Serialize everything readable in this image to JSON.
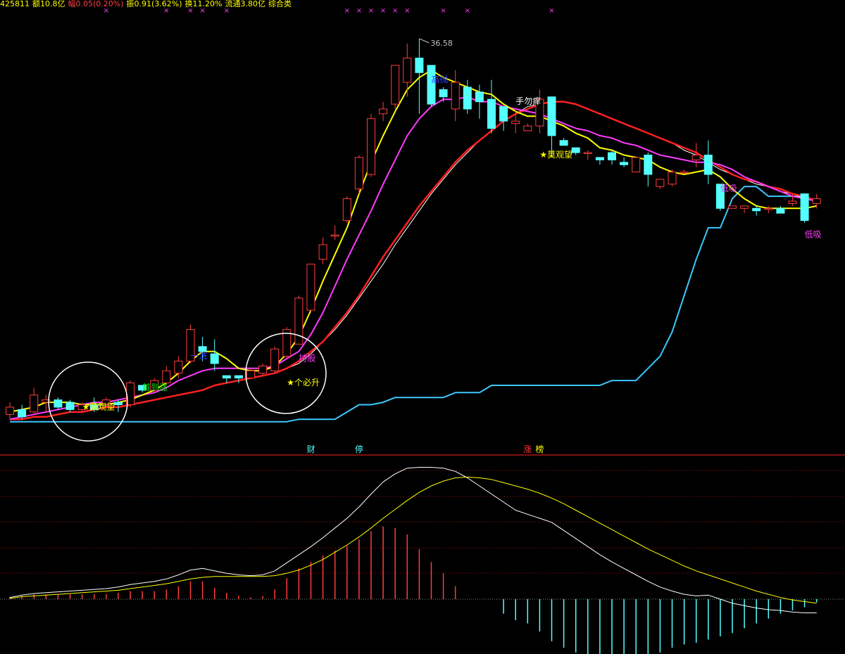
{
  "header": {
    "items": [
      {
        "text": "425811",
        "color": "#ffff00"
      },
      {
        "text": "额10.8亿",
        "color": "#ffff00"
      },
      {
        "text": "幅0.05(0.20%)",
        "color": "#ff4040"
      },
      {
        "text": "振0.91(3.62%)",
        "color": "#ffff00"
      },
      {
        "text": "换11.20%",
        "color": "#ffff00"
      },
      {
        "text": "流通3.80亿",
        "color": "#ffff00"
      },
      {
        "text": "综合类",
        "color": "#ffff00"
      }
    ]
  },
  "colors": {
    "up": "#ff3c3c",
    "down": "#54ffff",
    "ma_fast": "#ffff00",
    "ma_mid": "#ff3cff",
    "ma_slow": "#ff2020",
    "ma_white": "#ffffff",
    "band": "#3cc8ff",
    "divider": "#ff2020"
  },
  "chart_data": [
    {
      "type": "candlestick",
      "high_label": "36.58",
      "candles": [
        [
          21.1,
          21.4,
          20.9,
          21.6
        ],
        [
          21.3,
          21.0,
          20.9,
          21.5
        ],
        [
          21.2,
          21.9,
          21.1,
          22.2
        ],
        [
          21.6,
          21.7,
          21.2,
          21.9
        ],
        [
          21.7,
          21.4,
          21.3,
          21.8
        ],
        [
          21.6,
          21.3,
          21.2,
          21.7
        ],
        [
          21.3,
          21.5,
          21.2,
          21.6
        ],
        [
          21.5,
          21.3,
          21.2,
          21.8
        ],
        [
          21.5,
          21.7,
          21.4,
          21.8
        ],
        [
          21.6,
          21.5,
          21.2,
          21.7
        ],
        [
          21.5,
          22.4,
          21.4,
          22.5
        ],
        [
          22.3,
          22.1,
          22.0,
          22.3
        ],
        [
          22.1,
          22.5,
          22.0,
          22.6
        ],
        [
          22.4,
          22.9,
          22.3,
          23.1
        ],
        [
          22.8,
          23.3,
          22.6,
          23.5
        ],
        [
          23.3,
          24.6,
          23.2,
          24.8
        ],
        [
          23.9,
          23.7,
          23.3,
          24.3
        ],
        [
          23.6,
          23.2,
          22.9,
          24.2
        ],
        [
          22.7,
          22.6,
          22.4,
          22.7
        ],
        [
          22.7,
          22.6,
          22.4,
          22.6
        ],
        [
          22.6,
          22.9,
          22.6,
          23.0
        ],
        [
          22.8,
          23.1,
          22.7,
          23.2
        ],
        [
          22.9,
          23.8,
          22.8,
          23.9
        ],
        [
          23.5,
          24.6,
          23.4,
          24.7
        ],
        [
          24.0,
          25.9,
          24.0,
          26.0
        ],
        [
          25.4,
          27.3,
          25.3,
          27.3
        ],
        [
          27.5,
          28.1,
          27.3,
          28.4
        ],
        [
          28.5,
          28.5,
          28.3,
          28.9
        ],
        [
          29.1,
          30.0,
          29.0,
          30.1
        ],
        [
          30.4,
          31.7,
          30.2,
          31.8
        ],
        [
          31.0,
          33.3,
          30.9,
          33.5
        ],
        [
          33.5,
          33.7,
          33.2,
          34.0
        ],
        [
          33.9,
          35.5,
          33.7,
          35.5
        ],
        [
          34.8,
          35.8,
          34.2,
          36.4
        ],
        [
          35.8,
          35.2,
          33.5,
          36.6
        ],
        [
          35.5,
          33.9,
          33.8,
          35.5
        ],
        [
          34.5,
          34.2,
          34.0,
          34.6
        ],
        [
          33.7,
          34.8,
          33.2,
          35.3
        ],
        [
          34.6,
          33.7,
          33.5,
          34.9
        ],
        [
          34.4,
          34.0,
          33.3,
          34.7
        ],
        [
          34.1,
          32.9,
          32.7,
          34.9
        ],
        [
          33.8,
          33.2,
          32.8,
          33.8
        ],
        [
          33.1,
          33.2,
          32.7,
          33.7
        ],
        [
          32.8,
          33.0,
          32.8,
          33.1
        ],
        [
          33.0,
          34.1,
          32.7,
          34.5
        ],
        [
          34.2,
          32.6,
          31.7,
          34.2
        ],
        [
          32.4,
          32.2,
          32.2,
          32.5
        ],
        [
          32.1,
          31.9,
          31.8,
          32.1
        ],
        [
          31.9,
          31.9,
          31.6,
          32.0
        ],
        [
          31.7,
          31.6,
          31.4,
          31.7
        ],
        [
          31.9,
          31.6,
          31.4,
          32.0
        ],
        [
          31.5,
          31.4,
          31.3,
          31.7
        ],
        [
          31.1,
          31.7,
          31.1,
          31.7
        ],
        [
          31.8,
          31.0,
          30.5,
          31.9
        ],
        [
          30.5,
          30.8,
          30.4,
          30.8
        ],
        [
          30.6,
          31.1,
          30.5,
          31.2
        ],
        [
          31.1,
          31.1,
          31.1,
          31.2
        ],
        [
          31.6,
          31.8,
          31.3,
          32.3
        ],
        [
          31.8,
          31.0,
          30.6,
          32.4
        ],
        [
          30.6,
          29.6,
          29.5,
          30.6
        ],
        [
          29.6,
          29.7,
          29.6,
          29.7
        ],
        [
          29.6,
          29.7,
          29.4,
          29.7
        ],
        [
          29.6,
          29.5,
          29.3,
          29.7
        ],
        [
          29.6,
          29.6,
          29.4,
          29.7
        ],
        [
          29.6,
          29.4,
          29.4,
          29.7
        ],
        [
          29.8,
          29.9,
          29.7,
          30.2
        ],
        [
          30.2,
          29.1,
          29.0,
          30.2
        ],
        [
          29.8,
          30.0,
          29.6,
          30.2
        ]
      ],
      "ma_fast": [
        21.2,
        21.3,
        21.4,
        21.6,
        21.6,
        21.6,
        21.5,
        21.5,
        21.5,
        21.6,
        21.7,
        21.9,
        22.1,
        22.4,
        22.8,
        23.3,
        23.7,
        23.7,
        23.4,
        23.0,
        22.9,
        22.9,
        23.1,
        23.6,
        24.3,
        25.4,
        26.6,
        27.7,
        28.8,
        30.2,
        31.5,
        32.6,
        33.6,
        34.5,
        35.0,
        35.3,
        35.0,
        34.8,
        34.6,
        34.4,
        34.3,
        33.9,
        33.6,
        33.4,
        33.4,
        33.2,
        33.0,
        32.7,
        32.5,
        32.1,
        32.0,
        31.8,
        31.7,
        31.6,
        31.3,
        31.1,
        31.0,
        31.1,
        31.2,
        30.9,
        30.4,
        30.0,
        29.7,
        29.6,
        29.6,
        29.6,
        29.6,
        29.7
      ],
      "ma_mid": [
        20.9,
        21.0,
        21.1,
        21.2,
        21.3,
        21.4,
        21.5,
        21.6,
        21.6,
        21.7,
        21.8,
        21.9,
        22.0,
        22.2,
        22.5,
        22.7,
        22.9,
        23.0,
        23.0,
        23.0,
        23.0,
        23.0,
        23.1,
        23.4,
        23.7,
        24.4,
        25.3,
        26.4,
        27.5,
        28.5,
        29.5,
        30.6,
        31.6,
        32.6,
        33.3,
        33.8,
        34.1,
        34.1,
        34.2,
        34.0,
        34.0,
        33.8,
        33.7,
        33.6,
        33.5,
        33.3,
        33.1,
        32.9,
        32.8,
        32.6,
        32.5,
        32.3,
        32.2,
        32.0,
        31.8,
        31.7,
        31.6,
        31.5,
        31.5,
        31.4,
        31.2,
        30.9,
        30.7,
        30.5,
        30.3,
        30.1,
        30.0,
        29.9
      ],
      "ma_slow": [
        20.9,
        20.9,
        21.0,
        21.0,
        21.1,
        21.2,
        21.2,
        21.3,
        21.4,
        21.4,
        21.5,
        21.6,
        21.7,
        21.8,
        21.9,
        22.0,
        22.1,
        22.3,
        22.4,
        22.5,
        22.6,
        22.7,
        22.8,
        23.0,
        23.3,
        23.7,
        24.1,
        24.7,
        25.3,
        26.0,
        26.8,
        27.6,
        28.3,
        29.0,
        29.7,
        30.3,
        30.9,
        31.5,
        32.0,
        32.4,
        32.8,
        33.2,
        33.5,
        33.7,
        33.9,
        34.0,
        34.0,
        33.9,
        33.7,
        33.5,
        33.3,
        33.1,
        32.9,
        32.7,
        32.5,
        32.3,
        32.1,
        31.9,
        31.6,
        31.3,
        31.0,
        30.8,
        30.7,
        30.5,
        30.4,
        30.2,
        30.1,
        29.9
      ],
      "ma_white": [
        20.9,
        20.9,
        21.0,
        21.0,
        21.1,
        21.2,
        21.2,
        21.3,
        21.4,
        21.4,
        21.5,
        21.6,
        21.7,
        21.8,
        21.9,
        22.0,
        22.1,
        22.3,
        22.4,
        22.5,
        22.6,
        22.7,
        22.8,
        23.0,
        23.2,
        23.6,
        24.1,
        24.6,
        25.2,
        25.9,
        26.6,
        27.3,
        28.1,
        28.8,
        29.5,
        30.2,
        30.8,
        31.4,
        31.9,
        32.4,
        32.8,
        33.2,
        33.5,
        33.8,
        33.9,
        34.0,
        34.0,
        33.9,
        33.7,
        33.5,
        33.3,
        33.1,
        32.9,
        32.7,
        32.5,
        32.3,
        32.0,
        31.8,
        31.5,
        31.2,
        31.0,
        30.8,
        30.6,
        30.5,
        30.3,
        30.2,
        30.0,
        29.9
      ],
      "band": [
        [
          0,
          20.8
        ],
        [
          23,
          20.8
        ],
        [
          24,
          20.9
        ],
        [
          27,
          20.9
        ],
        [
          28,
          21.2
        ],
        [
          29,
          21.5
        ],
        [
          30,
          21.5
        ],
        [
          31,
          21.6
        ],
        [
          32,
          21.8
        ],
        [
          36,
          21.8
        ],
        [
          37,
          22.0
        ],
        [
          39,
          22.0
        ],
        [
          40,
          22.3
        ],
        [
          49,
          22.3
        ],
        [
          50,
          22.5
        ],
        [
          52,
          22.5
        ],
        [
          53,
          23.0
        ],
        [
          54,
          23.5
        ],
        [
          55,
          24.5
        ],
        [
          56,
          26.0
        ],
        [
          57,
          27.5
        ],
        [
          58,
          28.8
        ],
        [
          59,
          28.8
        ],
        [
          60,
          30.0
        ],
        [
          61,
          30.5
        ],
        [
          62,
          30.5
        ],
        [
          63,
          30.1
        ],
        [
          66,
          30.1
        ],
        [
          67,
          29.9
        ]
      ],
      "labels": [
        {
          "text": "★莫观望",
          "i": 6,
          "price": 21.3,
          "color": "#ffff00"
        },
        {
          "text": "首到涨",
          "i": 11,
          "price": 22.1,
          "color": "#00e000"
        },
        {
          "text": "一洗",
          "i": 15,
          "price": 23.4,
          "color": "#3040ff"
        },
        {
          "text": "持股",
          "i": 24,
          "price": 23.3,
          "color": "#ff3cff"
        },
        {
          "text": "★个必升",
          "i": 23,
          "price": 22.3,
          "color": "#ffff00"
        },
        {
          "text": "高抛",
          "i": 35,
          "price": 34.8,
          "color": "#3040ff"
        },
        {
          "text": "手勿痒",
          "i": 42,
          "price": 33.9,
          "color": "#ffffff"
        },
        {
          "text": "★莫观望",
          "i": 44,
          "price": 31.7,
          "color": "#ffff00"
        },
        {
          "text": "低吸",
          "i": 59,
          "price": 30.3,
          "color": "#ff3cff"
        },
        {
          "text": "低吸",
          "i": 66,
          "price": 28.4,
          "color": "#ff3cff"
        }
      ],
      "top_markers": [
        8,
        13,
        15,
        16,
        18,
        28,
        29,
        30,
        31,
        32,
        33,
        36,
        38,
        45
      ],
      "bottom_markers": [
        {
          "text": "财",
          "i": 25,
          "color": "#54ffff"
        },
        {
          "text": "停",
          "i": 29,
          "color": "#54ffff"
        },
        {
          "text": "涨",
          "i": 43,
          "color": "#ff3c3c"
        },
        {
          "text": "榜",
          "i": 44,
          "color": "#ffff00"
        }
      ]
    },
    {
      "type": "macd",
      "ylim": [
        -1.0,
        1.7
      ],
      "dif": [
        0.02,
        0.05,
        0.07,
        0.08,
        0.09,
        0.1,
        0.11,
        0.12,
        0.13,
        0.15,
        0.18,
        0.2,
        0.22,
        0.25,
        0.3,
        0.36,
        0.38,
        0.35,
        0.32,
        0.3,
        0.29,
        0.3,
        0.35,
        0.45,
        0.55,
        0.65,
        0.76,
        0.88,
        1.0,
        1.14,
        1.3,
        1.45,
        1.55,
        1.62,
        1.63,
        1.63,
        1.62,
        1.58,
        1.5,
        1.4,
        1.3,
        1.2,
        1.1,
        1.05,
        1.0,
        0.95,
        0.85,
        0.75,
        0.65,
        0.55,
        0.46,
        0.38,
        0.3,
        0.22,
        0.15,
        0.1,
        0.06,
        0.04,
        0.05,
        0.0,
        -0.05,
        -0.08,
        -0.11,
        -0.13,
        -0.14,
        -0.16,
        -0.17,
        -0.17
      ],
      "dea": [
        0.01,
        0.03,
        0.04,
        0.05,
        0.06,
        0.07,
        0.08,
        0.09,
        0.1,
        0.11,
        0.13,
        0.15,
        0.17,
        0.19,
        0.22,
        0.25,
        0.27,
        0.28,
        0.28,
        0.28,
        0.28,
        0.28,
        0.29,
        0.32,
        0.36,
        0.42,
        0.49,
        0.58,
        0.67,
        0.77,
        0.88,
        1.0,
        1.11,
        1.22,
        1.32,
        1.4,
        1.46,
        1.5,
        1.51,
        1.5,
        1.48,
        1.44,
        1.4,
        1.36,
        1.31,
        1.25,
        1.18,
        1.1,
        1.02,
        0.94,
        0.86,
        0.78,
        0.7,
        0.62,
        0.55,
        0.48,
        0.41,
        0.35,
        0.3,
        0.25,
        0.2,
        0.15,
        0.1,
        0.06,
        0.02,
        -0.01,
        -0.03,
        -0.05
      ],
      "hist": [
        0.03,
        0.04,
        0.06,
        0.06,
        0.06,
        0.06,
        0.06,
        0.06,
        0.06,
        0.08,
        0.1,
        0.1,
        0.1,
        0.12,
        0.16,
        0.22,
        0.22,
        0.14,
        0.08,
        0.04,
        0.02,
        0.04,
        0.12,
        0.26,
        0.38,
        0.46,
        0.54,
        0.6,
        0.66,
        0.74,
        0.84,
        0.9,
        0.88,
        0.8,
        0.62,
        0.46,
        0.32,
        0.16,
        0,
        0,
        0,
        -0.18,
        -0.26,
        -0.3,
        -0.4,
        -0.52,
        -0.6,
        -0.66,
        -0.7,
        -0.74,
        -0.76,
        -0.74,
        -0.74,
        -0.7,
        -0.66,
        -0.6,
        -0.56,
        -0.54,
        -0.5,
        -0.46,
        -0.42,
        -0.36,
        -0.3,
        -0.24,
        -0.18,
        -0.14,
        -0.1,
        -0.04
      ]
    }
  ]
}
